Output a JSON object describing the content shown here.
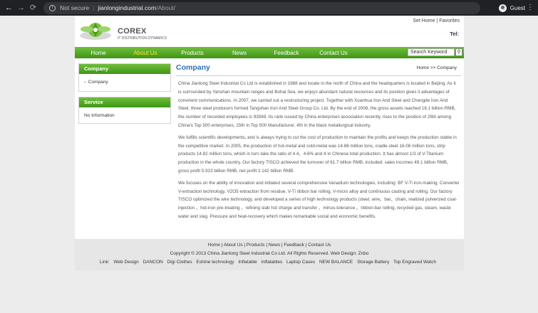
{
  "browser": {
    "not_secure": "Not secure",
    "host": "jianlongindustrial.com",
    "path": "/About/",
    "profile": "Guest"
  },
  "header": {
    "brand": "COREX",
    "tagline": "IT DISTRIBUTION DYNAMICS",
    "set_home": "Set Home",
    "favorites": "Favorites",
    "tel": "Tel:"
  },
  "nav": {
    "items": [
      {
        "label": "Home"
      },
      {
        "label": "About Us"
      },
      {
        "label": "Products"
      },
      {
        "label": "News"
      },
      {
        "label": "Feedback"
      },
      {
        "label": "Contact Us"
      }
    ],
    "search_placeholder": "Search Keyword",
    "search_icon": "search-icon"
  },
  "sidebar": {
    "company_title": "Company",
    "company_item": "Company",
    "service_title": "Service",
    "service_item": "No Information"
  },
  "main": {
    "title": "Company",
    "breadcrumb": "Home >> Company",
    "paragraphs": [
      "China Jianlong Steel Industrial Co Ltd is established in 1988 and locate in the north of China and the headquarters is located in Beijing. As it is surrounded by Yanshan mountain ranges and Bohai Sea, we enjoys abundant natural resources and its position gives it advantages of convinent communications.  In 2007, we carried out a restructuring project. Together with Xuanhua Iron And Steel and Chengde Iron And Steel, three steel producers formed Tangshan Iron And Steel Group Co. Ltd. By the end of 2008, the gross assets reached 18.1 billion RMB, the number of recorded employees is 93569. Its rank issued by China enterprises association recently, rises to the position of 26th among China's Top 500 enterprises, 15th in Top 500 Manufacturer, 4th in the black metallurgical industry.",
      "We fulfills scientific developments, and is always trying to cut the cost of production to maintain the profits and keeps the production stable in the competitive market. In 2005, the production of hot-metal and cold-metal was 14.86 million tons, cradle steel 16.08 million tons, strip products 14.82 million tons, which in turn take the ratio of 4.4、4.6% and 4 in Chinese total production. It has almost 1/3 of V-Titanium production in the whole country. Our factory TISCO achieved the turnover of 61.7 billion RMB, included: sales incomes 49.1 billion RMB, gross profit 5.923 billion RMB, net profit 2.142 billion RMB.",
      "We focuses on the ability of innovation and initiated several comprehensive Vanadium technologies, including: BF V-Ti iron-making, Converter V-extraction technology, V2O5 extraction from residue, V-Ti ribbon bar rolling, V-micro alloy and continuous casting and rolling. Our factory TISCO optimized the wire technology, and developed a series of high technology products (steel, wire、bar、chain, realized pulverized coal-injection 、hot-iron pre-treating 、refining slab hot charge and transfer 、minus-tolerance 、ribbon-bar rolling, recycled gas, steam, waste water and slag. Pressure and heat-recovery  which makes remarkable social and economic benefits."
    ]
  },
  "footer": {
    "nav_line": "Home | About Us | Products | News | Feedback | Contact Us",
    "copyright": "Copyright © 2013 China Jianlong Steel Industrial Co Ltd. All Rights Reserved.  Web Design: Znbo",
    "link_label": "Link:",
    "links": [
      "Web Design",
      "DANCON",
      "Digi Clothes",
      "Eshine technology",
      "Inflatable",
      "Inflatables",
      "Laptop Cases",
      "NEW BALANCE",
      "Storage Battery",
      "Top Engraved Watch"
    ]
  },
  "colors": {
    "nav_green": "#4ea623",
    "title_blue": "#2f6fb6",
    "active_yellow": "#ffe52e"
  }
}
